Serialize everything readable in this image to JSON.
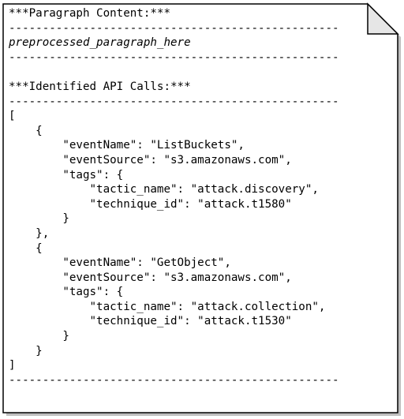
{
  "note": {
    "heading_paragraph": "***Paragraph Content:***",
    "separator": "-------------------------------------------------",
    "paragraph_placeholder": "preprocessed_paragraph_here",
    "heading_api_calls": "***Identified API Calls:***",
    "json_lines": [
      "[",
      "    {",
      "        \"eventName\": \"ListBuckets\",",
      "        \"eventSource\": \"s3.amazonaws.com\",",
      "        \"tags\": {",
      "            \"tactic_name\": \"attack.discovery\",",
      "            \"technique_id\": \"attack.t1580\"",
      "        }",
      "    },",
      "    {",
      "        \"eventName\": \"GetObject\",",
      "        \"eventSource\": \"s3.amazonaws.com\",",
      "        \"tags\": {",
      "            \"tactic_name\": \"attack.collection\",",
      "            \"technique_id\": \"attack.t1530\"",
      "        }",
      "    }",
      "]"
    ]
  }
}
